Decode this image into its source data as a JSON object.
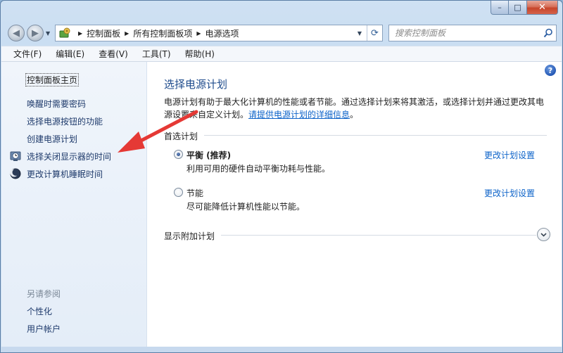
{
  "window": {
    "caption": {
      "minimize": "–",
      "maximize": "□",
      "close": "✕"
    }
  },
  "address": {
    "crumbs": [
      "控制面板",
      "所有控制面板项",
      "电源选项"
    ],
    "search_placeholder": "搜索控制面板"
  },
  "menubar": {
    "items": [
      "文件(F)",
      "编辑(E)",
      "查看(V)",
      "工具(T)",
      "帮助(H)"
    ]
  },
  "sidebar": {
    "home": "控制面板主页",
    "links": [
      "唤醒时需要密码",
      "选择电源按钮的功能",
      "创建电源计划",
      "选择关闭显示器的时间",
      "更改计算机睡眠时间"
    ],
    "see_also_label": "另请参阅",
    "see_also": [
      "个性化",
      "用户帐户"
    ]
  },
  "main": {
    "title": "选择电源计划",
    "description": "电源计划有助于最大化计算机的性能或者节能。通过选择计划来将其激活，或选择计划并通过更改其电源设置来自定义计划。",
    "description_link": "请提供电源计划的详细信息",
    "description_end": "。",
    "group_label": "首选计划",
    "plans": [
      {
        "name": "平衡 (推荐)",
        "desc": "利用可用的硬件自动平衡功耗与性能。",
        "change": "更改计划设置",
        "selected": true
      },
      {
        "name": "节能",
        "desc": "尽可能降低计算机性能以节能。",
        "change": "更改计划设置",
        "selected": false
      }
    ],
    "extra_plans_label": "显示附加计划",
    "help": "?"
  },
  "colors": {
    "link": "#0d63c9",
    "title": "#1e4b8c",
    "annotation_arrow": "#e53935"
  }
}
